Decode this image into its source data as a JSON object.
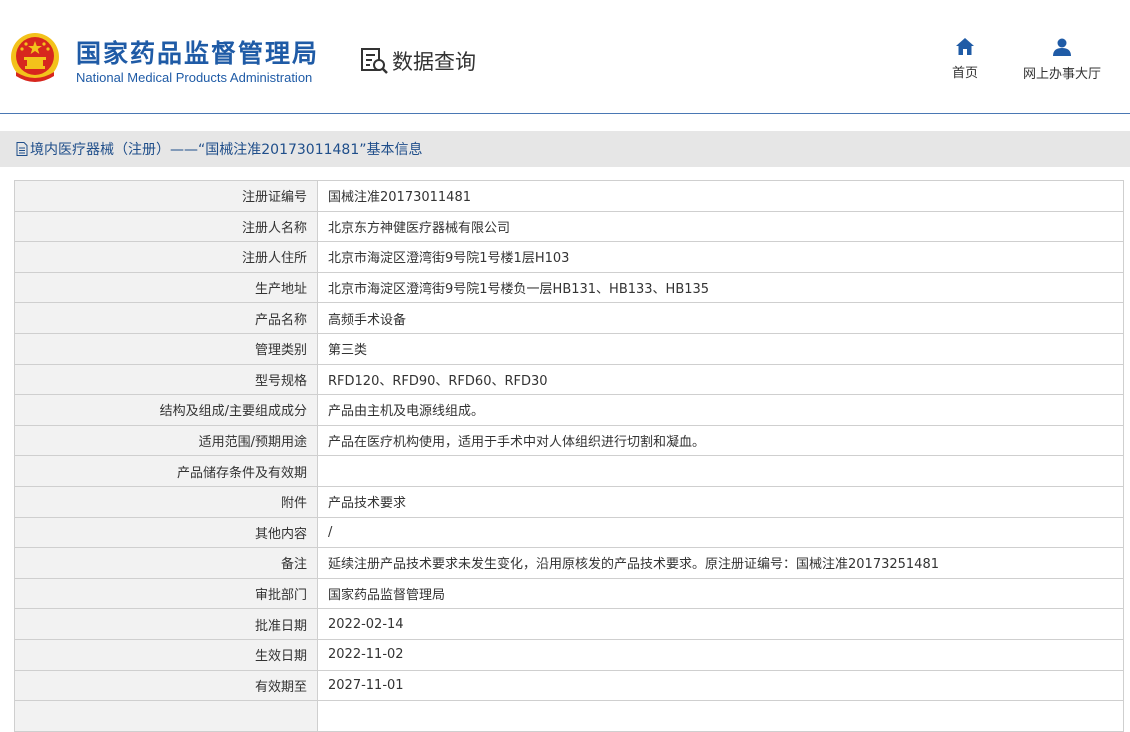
{
  "header": {
    "org_name_cn": "国家药品监督管理局",
    "org_name_en": "National Medical Products Administration",
    "section_title": "数据查询",
    "nav": {
      "home_label": "首页",
      "online_hall_label": "网上办事大厅"
    },
    "icons": [
      "national-emblem-icon",
      "data-query-icon",
      "home-icon",
      "user-icon"
    ]
  },
  "page": {
    "title": "境内医疗器械（注册）——“国械注准20173011481”基本信息"
  },
  "details": [
    {
      "label": "注册证编号",
      "value": "国械注准20173011481"
    },
    {
      "label": "注册人名称",
      "value": "北京东方神健医疗器械有限公司"
    },
    {
      "label": "注册人住所",
      "value": "北京市海淀区澄湾街9号院1号楼1层H103"
    },
    {
      "label": "生产地址",
      "value": "北京市海淀区澄湾街9号院1号楼负一层HB131、HB133、HB135"
    },
    {
      "label": "产品名称",
      "value": "高频手术设备"
    },
    {
      "label": "管理类别",
      "value": "第三类"
    },
    {
      "label": "型号规格",
      "value": "RFD120、RFD90、RFD60、RFD30"
    },
    {
      "label": "结构及组成/主要组成成分",
      "value": "产品由主机及电源线组成。"
    },
    {
      "label": "适用范围/预期用途",
      "value": "产品在医疗机构使用，适用于手术中对人体组织进行切割和凝血。"
    },
    {
      "label": "产品储存条件及有效期",
      "value": ""
    },
    {
      "label": "附件",
      "value": "产品技术要求"
    },
    {
      "label": "其他内容",
      "value": "/"
    },
    {
      "label": "备注",
      "value": "延续注册产品技术要求未发生变化，沿用原核发的产品技术要求。原注册证编号：国械注准20173251481"
    },
    {
      "label": "审批部门",
      "value": "国家药品监督管理局"
    },
    {
      "label": "批准日期",
      "value": "2022-02-14"
    },
    {
      "label": "生效日期",
      "value": "2022-11-02"
    },
    {
      "label": "有效期至",
      "value": "2027-11-01"
    },
    {
      "label": "",
      "value": ""
    }
  ],
  "colors": {
    "brand_blue": "#1f5ba6",
    "emblem_red": "#d7261e",
    "emblem_gold": "#f3c21b",
    "title_bar_bg": "#e6e6e6",
    "label_bg": "#f2f2f2"
  }
}
